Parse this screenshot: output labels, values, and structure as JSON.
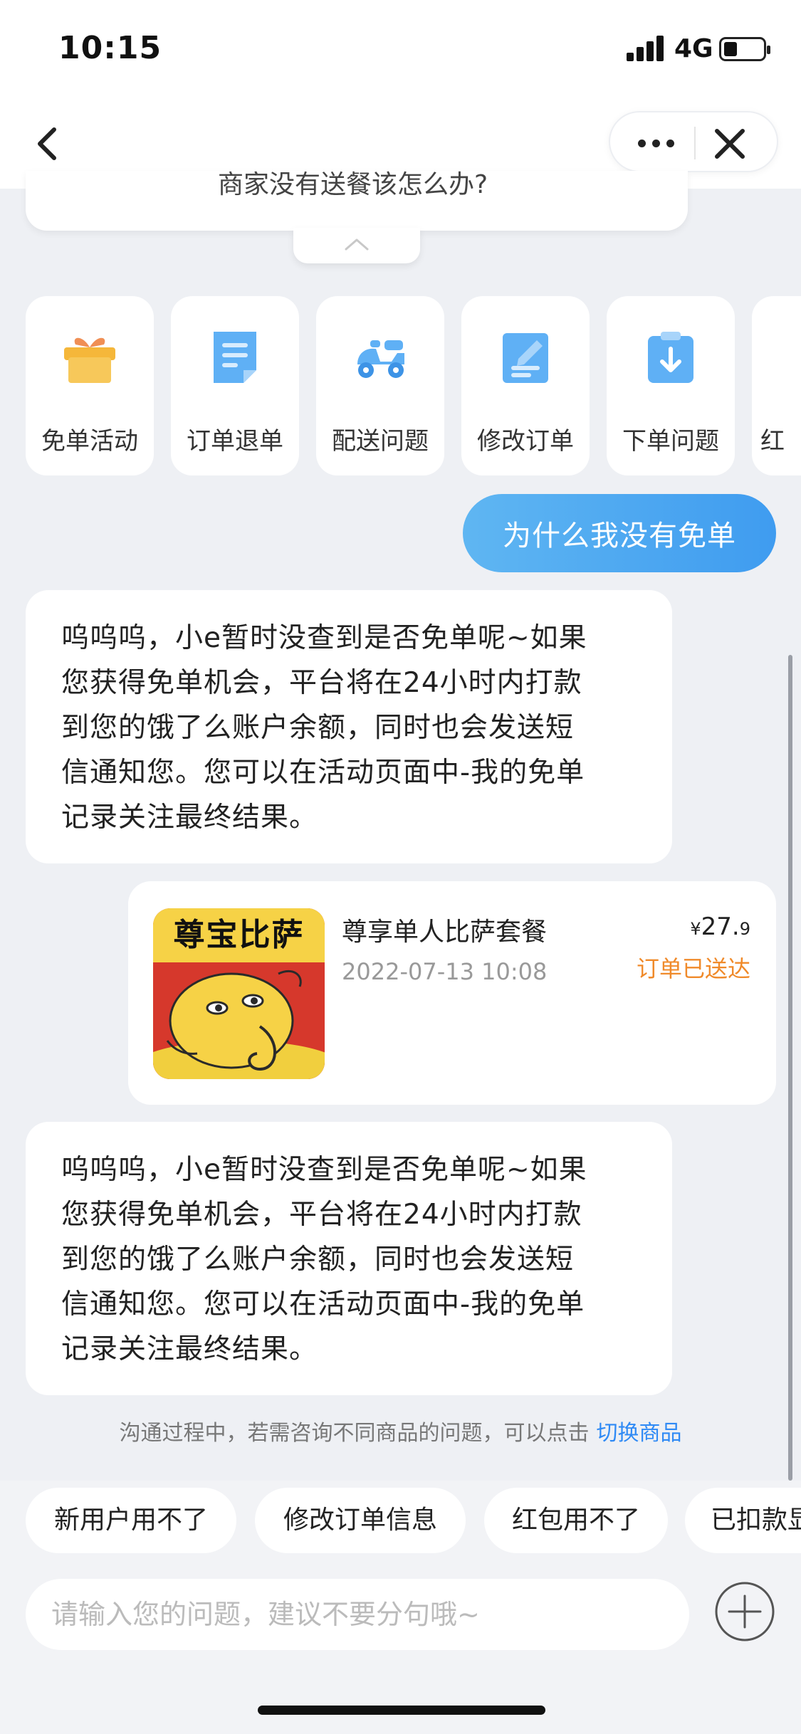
{
  "status_bar": {
    "time": "10:15",
    "network": "4G"
  },
  "previous_card_text": "商家没有送餐该怎么办?",
  "categories": [
    {
      "label": "免单活动",
      "icon": "gift-icon"
    },
    {
      "label": "订单退单",
      "icon": "document-icon"
    },
    {
      "label": "配送问题",
      "icon": "scooter-icon"
    },
    {
      "label": "修改订单",
      "icon": "edit-document-icon"
    },
    {
      "label": "下单问题",
      "icon": "clipboard-download-icon"
    },
    {
      "label": "红",
      "icon": "partial-icon"
    }
  ],
  "user_message": "为什么我没有免单",
  "bot_messages": [
    {
      "lines": [
        "呜呜呜，小e暂时没查到是否免单呢~如果",
        "您获得免单机会，平台将在24小时内打款",
        "到您的饿了么账户余额，同时也会发送短",
        "信通知您。您可以在活动页面中-我的免单",
        "记录关注最终结果。"
      ]
    },
    {
      "lines": [
        "呜呜呜，小e暂时没查到是否免单呢~如果",
        "您获得免单机会，平台将在24小时内打款",
        "到您的饿了么账户余额，同时也会发送短",
        "信通知您。您可以在活动页面中-我的免单",
        "记录关注最终结果。"
      ]
    }
  ],
  "order": {
    "store_logo_text": "尊宝比萨",
    "name": "尊享单人比萨套餐",
    "date": "2022-07-13 10:08",
    "price_currency": "¥",
    "price_main": "27.",
    "price_decimal": "9",
    "status": "订单已送达"
  },
  "hint": {
    "text": "沟通过程中，若需咨询不同商品的问题，可以点击",
    "link": "切换商品"
  },
  "quick_replies": [
    "新用户用不了",
    "修改订单信息",
    "红包用不了",
    "已扣款显"
  ],
  "input": {
    "placeholder": "请输入您的问题，建议不要分句哦~"
  },
  "colors": {
    "accent": "#3f9cf0",
    "status_orange": "#f08a2a",
    "link": "#2f8af5"
  }
}
